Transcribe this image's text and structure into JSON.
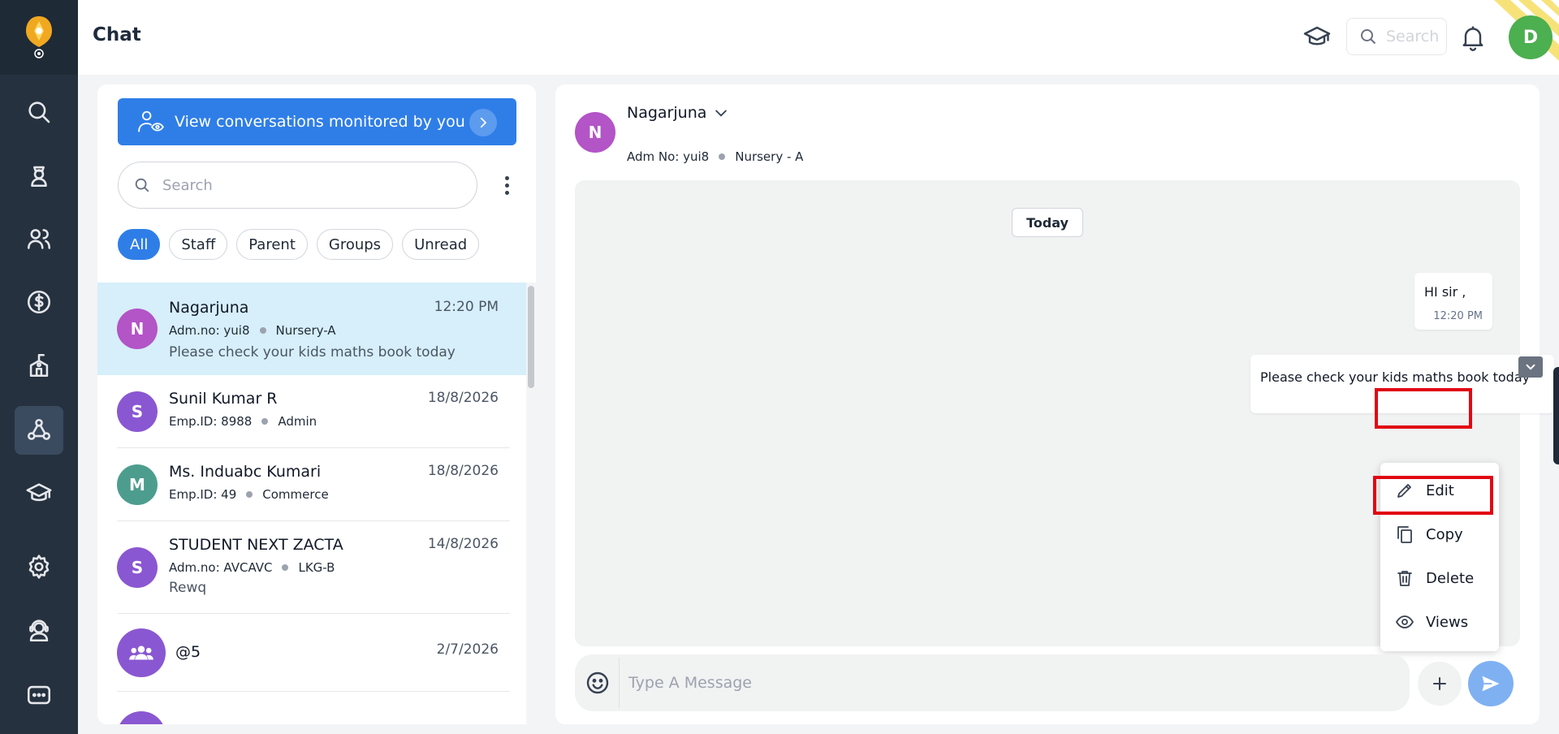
{
  "header": {
    "title": "Chat",
    "search_placeholder": "Search",
    "avatar_initial": "D"
  },
  "left": {
    "monitor_label": "View conversations monitored by you",
    "search_placeholder": "Search",
    "filters": [
      "All",
      "Staff",
      "Parent",
      "Groups",
      "Unread"
    ],
    "active_filter": "All",
    "conversations": [
      {
        "initial": "N",
        "color": "#b354c7",
        "name": "Nagarjuna",
        "time": "12:20 PM",
        "id": "Adm.no: yui8",
        "tag": "Nursery-A",
        "preview": "Please check your kids maths book today",
        "selected": true
      },
      {
        "initial": "S",
        "color": "#8a57d2",
        "name": "Sunil Kumar R",
        "time": "18/8/2026",
        "id": "Emp.ID: 8988",
        "tag": "Admin",
        "preview": ""
      },
      {
        "initial": "M",
        "color": "#4d9d8e",
        "name": "Ms. Induabc Kumari",
        "time": "18/8/2026",
        "id": "Emp.ID: 49",
        "tag": "Commerce",
        "preview": ""
      },
      {
        "initial": "S",
        "color": "#8a57d2",
        "name": "STUDENT NEXT ZACTA",
        "time": "14/8/2026",
        "id": "Adm.no: AVCAVC",
        "tag": "LKG-B",
        "preview": "Rewq"
      },
      {
        "initial": "group-icon",
        "color": "#8a57d2",
        "name": "@5",
        "time": "2/7/2026",
        "id": "",
        "tag": "",
        "preview": ""
      },
      {
        "initial": "",
        "color": "#8a57d2",
        "name": "",
        "time": "",
        "id": "",
        "tag": "",
        "preview": ""
      }
    ]
  },
  "chat": {
    "name": "Nagarjuna",
    "initial": "N",
    "adm": "Adm No: yui8",
    "class": "Nursery - A",
    "date_label": "Today",
    "messages": [
      {
        "text": "HI sir ,",
        "time": "12:20 PM"
      },
      {
        "text": "Please check your kids maths book today"
      }
    ],
    "menu": [
      {
        "label": "Edit",
        "icon": "pencil-icon",
        "highlighted": true
      },
      {
        "label": "Copy",
        "icon": "copy-icon",
        "highlighted": false
      },
      {
        "label": "Delete",
        "icon": "trash-icon",
        "highlighted": true
      },
      {
        "label": "Views",
        "icon": "eye-icon",
        "highlighted": false
      }
    ],
    "input_placeholder": "Type A Message"
  },
  "colors": {
    "primary": "#2f7ee8",
    "sidebar": "#26313f",
    "highlight": "#e10613",
    "selected_row": "#d6effa"
  }
}
